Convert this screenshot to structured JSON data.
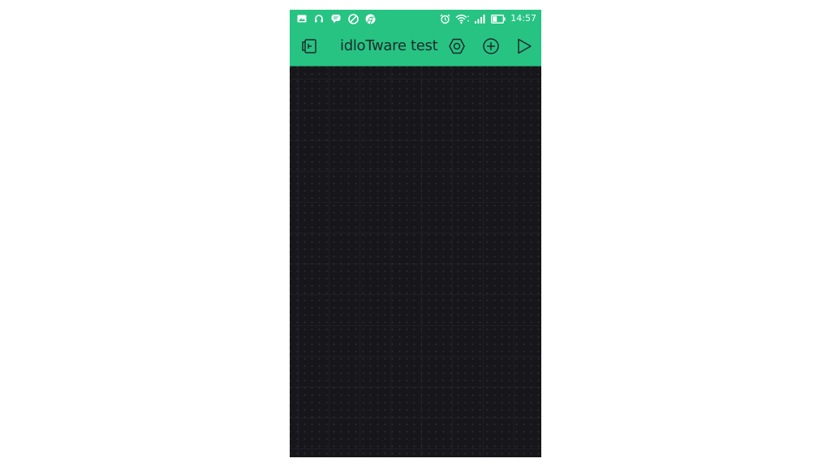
{
  "status_bar": {
    "left_icons": [
      "gallery-icon",
      "headset-icon",
      "message-icon",
      "blocked-icon",
      "chrome-icon"
    ],
    "right_icons": [
      "alarm-icon",
      "wifi-icon",
      "signal-icon",
      "battery-icon"
    ],
    "time": "14:57"
  },
  "toolbar": {
    "title": "idloTware test",
    "left_icon": "back-exit-icon",
    "actions": [
      "settings-hexagon-icon",
      "add-widget-icon",
      "play-icon"
    ]
  },
  "colors": {
    "accent": "#27c383",
    "canvas": "#16161b",
    "title_text": "#1e2a2a"
  }
}
